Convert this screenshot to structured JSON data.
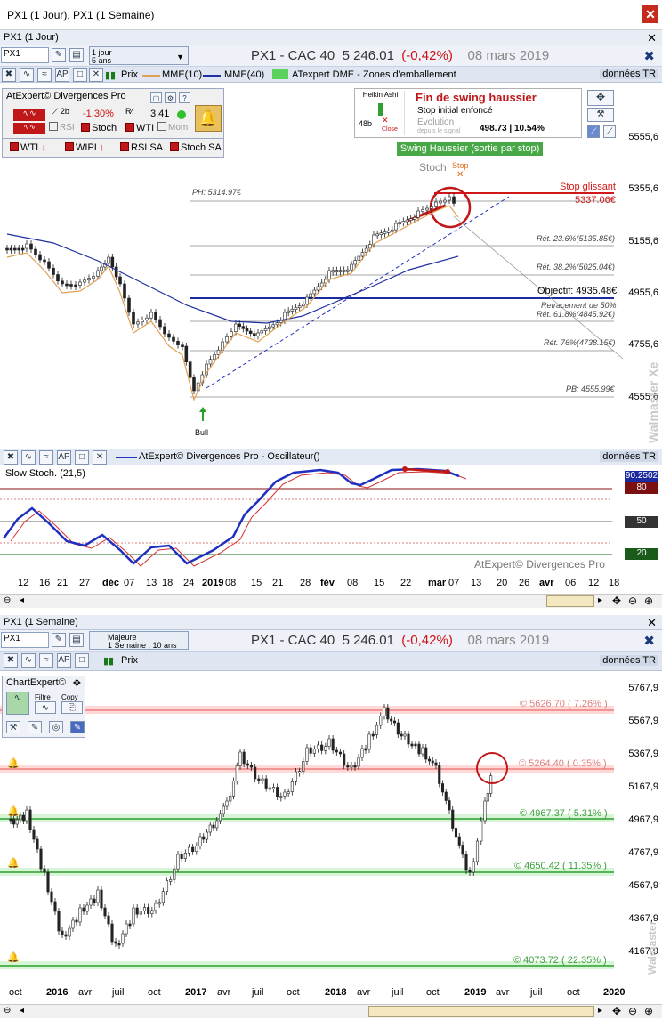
{
  "window": {
    "title": "PX1 (1 Jour), PX1 (1 Semaine)"
  },
  "colors": {
    "up": "#2ca02c",
    "down": "#e05050",
    "blue": "#2030a0",
    "red": "#c01818"
  },
  "daily": {
    "pane_title": "PX1 (1 Jour)",
    "symbol": "PX1",
    "period_main": "1 jour",
    "period_sub": "5 ans",
    "header": {
      "name": "PX1 - CAC 40",
      "price": "5 246.01",
      "change": "(-0,42%)",
      "date": "08 mars 2019"
    },
    "toolbar": {
      "prix": "Prix",
      "mme10": "MME(10)",
      "mme40": "MME(40)",
      "zones": "ATexpert DME - Zones d'emballement",
      "donnees": "données TR"
    },
    "diverg": {
      "title": "AtExpert© Divergences Pro",
      "pct": "-1.30%",
      "val": "3.41",
      "rsi": "RSI",
      "stoch": "Stoch",
      "wti": "WTI",
      "mom": "Mom",
      "wti2": "WTI",
      "wipi": "WIPI",
      "rsisa": "RSI SA",
      "stochsa": "Stoch SA",
      "num2b": "2b"
    },
    "signal": {
      "heikin": "Heikin Ashi",
      "n48": "48b",
      "close": "Close",
      "title": "Fin de swing haussier",
      "sub": "Stop initial enfoncé",
      "evo": "Evolution",
      "depuis": "depuis le signal",
      "value": "498.73 | 10.54%",
      "swing": "Swing Haussier (sortie par stop)"
    },
    "annotations": {
      "stoch": "Stoch",
      "stop": "Stop",
      "stopgl": "Stop glissant",
      "stopv": "5337.06€",
      "ph": "PH: 5314.97€",
      "r236": "Rét. 23.6%(5135.85€)",
      "r382": "Rét. 38.2%(5025.04€)",
      "obj": "Objectif: 4935.48€",
      "r50": "Retracement de 50%",
      "r618": "Rét. 61.8%(4845.92€)",
      "r76": "Rét. 76%(4738.15€)",
      "pb": "PB: 4555.99€",
      "bull": "Bull"
    },
    "yticks": [
      "5555,6",
      "5355,6",
      "5155,6",
      "4955,6",
      "4755,6",
      "4555,6"
    ],
    "brand": "Walmaster Xe",
    "osc": {
      "title": "AtExpert© Divergences Pro - Oscillateur()",
      "label": "Slow Stoch. (21,5)",
      "donnees": "données TR",
      "v1": "90.2502",
      "v2": "80",
      "v3": "50",
      "v4": "20",
      "brand": "AtExpert© Divergences Pro"
    },
    "xticks": [
      "12",
      "16",
      "21",
      "27",
      "déc",
      "07",
      "13",
      "18",
      "24",
      "2019",
      "08",
      "15",
      "21",
      "28",
      "fév",
      "08",
      "15",
      "22",
      "mar",
      "07",
      "13",
      "20",
      "26",
      "avr",
      "06",
      "12",
      "18"
    ]
  },
  "weekly": {
    "pane_title": "PX1 (1 Semaine)",
    "symbol": "PX1",
    "period_main": "Majeure",
    "period_sub": "1 Semaine , 10 ans",
    "header": {
      "name": "PX1 - CAC 40",
      "price": "5 246.01",
      "change": "(-0,42%)",
      "date": "08 mars 2019"
    },
    "toolbar": {
      "prix": "Prix",
      "donnees": "données TR"
    },
    "ce": {
      "title": "ChartExpert©",
      "filtre": "Filtre",
      "copy": "Copy"
    },
    "levels": [
      "© 5626.70 ( 7.26% )",
      "© 5264.40 ( 0.35% )",
      "© 4967.37 ( 5.31% )",
      "© 4650.42 ( 11.35% )",
      "© 4073.72 ( 22.35% )"
    ],
    "yticks": [
      "5767,9",
      "5567,9",
      "5367,9",
      "5167,9",
      "4967,9",
      "4767,9",
      "4567,9",
      "4367,9",
      "4167,9"
    ],
    "brand": "Walmaster",
    "xticks": [
      "oct",
      "2016",
      "avr",
      "juil",
      "oct",
      "2017",
      "avr",
      "juil",
      "oct",
      "2018",
      "avr",
      "juil",
      "oct",
      "2019",
      "avr",
      "juil",
      "oct",
      "2020"
    ]
  }
}
